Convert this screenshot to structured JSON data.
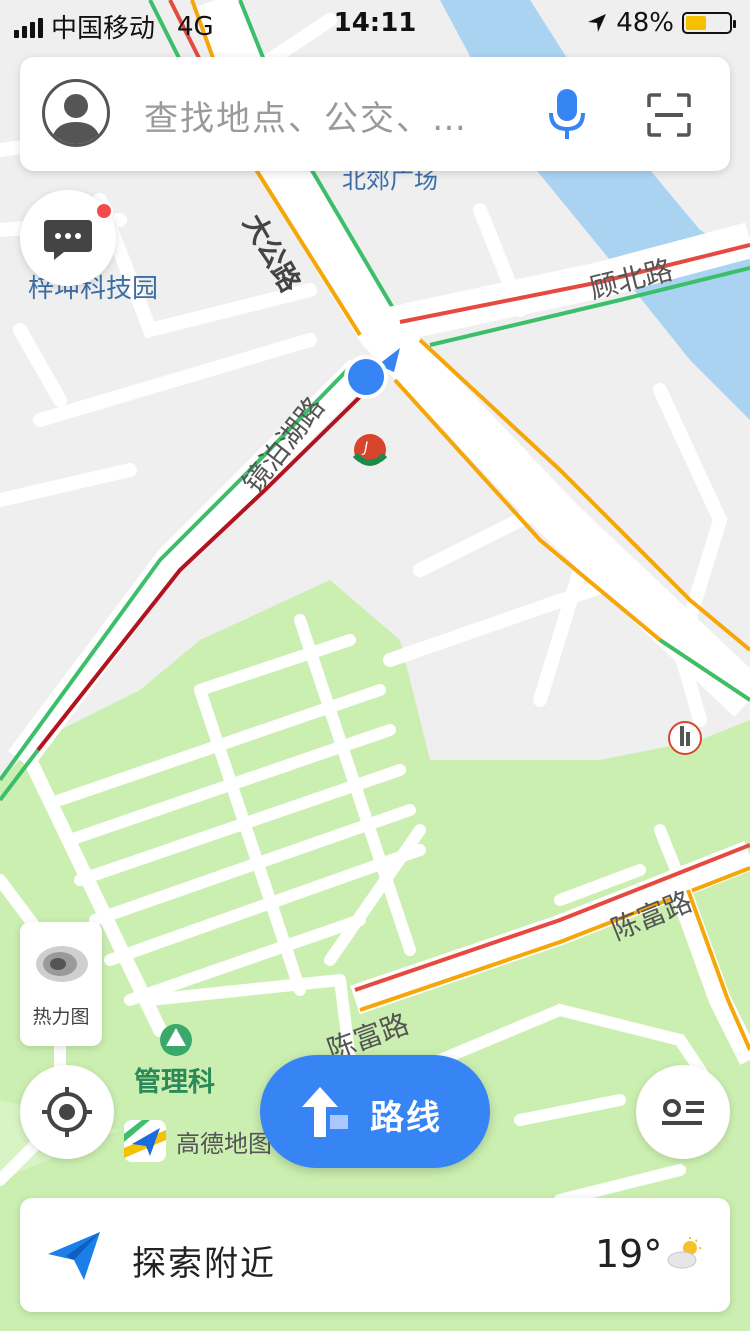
{
  "status_bar": {
    "carrier": "中国移动",
    "network": "4G",
    "time": "14:11",
    "battery": "48%",
    "battery_level": 0.48
  },
  "search": {
    "placeholder": "查找地点、公交、…"
  },
  "map_labels": {
    "road_da_gong": "大公路",
    "road_gu_bei": "顾北路",
    "road_jing_bo_hu": "镜泊湖路",
    "road_chen_fu_1": "陈富路",
    "road_chen_fu_2": "陈富路",
    "place_bei_jiao": "北郊广场",
    "place_zi_hui": "梓坤科技园",
    "place_guan_li": "管理科"
  },
  "heatmap": {
    "label": "热力图"
  },
  "route_button": {
    "label": "路线"
  },
  "brand": {
    "label": "高德地图"
  },
  "explore": {
    "label": "探索附近"
  },
  "weather": {
    "temperature": "19°",
    "icon": "partly-cloudy-icon"
  },
  "colors": {
    "accent": "#3784f5",
    "park": "#cbefb0",
    "traffic_green": "#3cbf6a",
    "traffic_orange": "#f6a609",
    "traffic_red": "#e5493f",
    "traffic_darkred": "#b3121f",
    "water": "#aad3f2"
  }
}
